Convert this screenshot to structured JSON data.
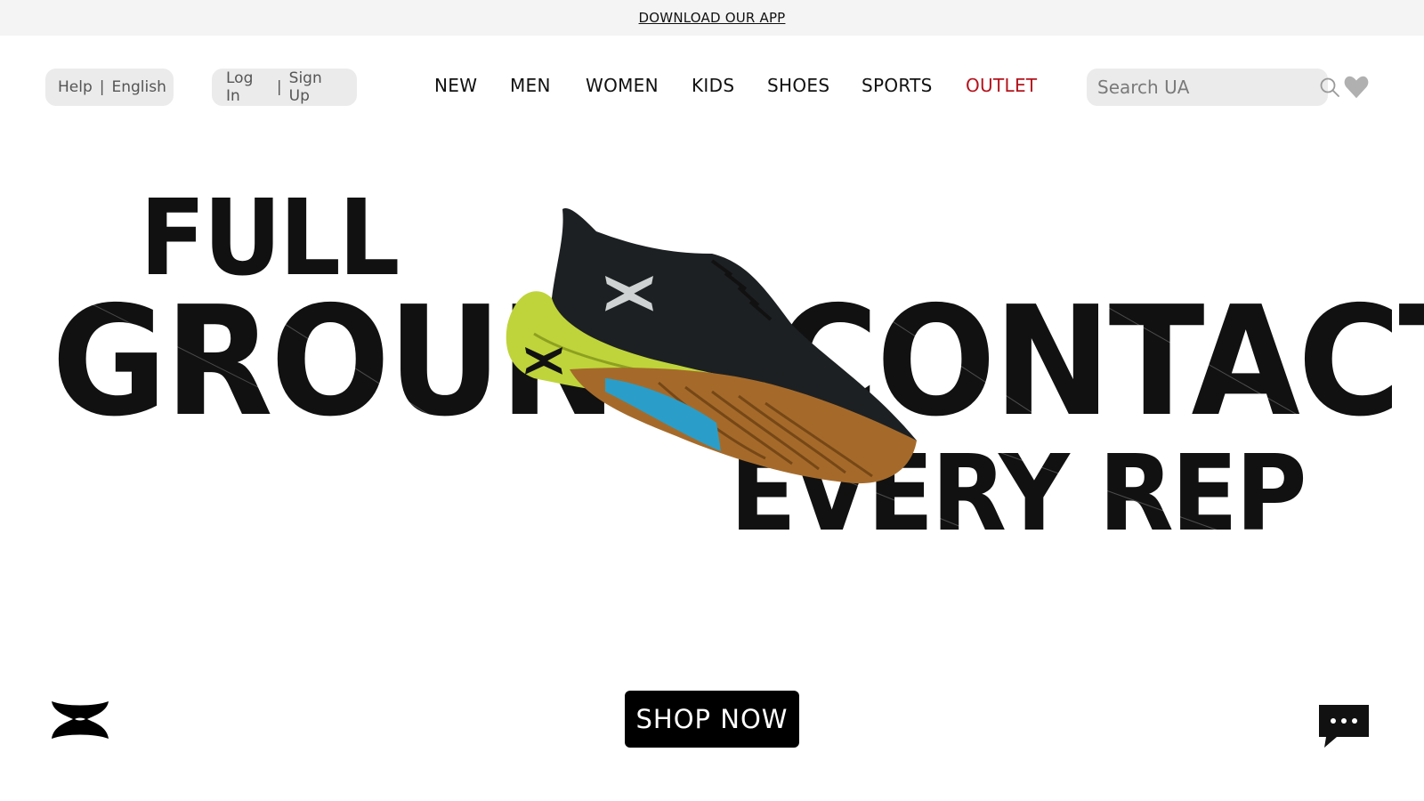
{
  "banner": {
    "link_text": "DOWNLOAD OUR APP"
  },
  "header": {
    "help": "Help",
    "language": "English",
    "separator": "|",
    "login": "Log In",
    "signup": "Sign Up",
    "nav": [
      {
        "label": "NEW"
      },
      {
        "label": "MEN"
      },
      {
        "label": "WOMEN"
      },
      {
        "label": "KIDS"
      },
      {
        "label": "SHOES"
      },
      {
        "label": "SPORTS"
      },
      {
        "label": "OUTLET",
        "color": "#b3141d"
      }
    ],
    "search_placeholder": "Search UA",
    "icons": {
      "search": "search-icon",
      "wishlist": "heart-icon"
    }
  },
  "hero": {
    "line1": "FULL",
    "line2": "GROUND CONTACT",
    "line3": "EVERY REP",
    "image": "training-shoe",
    "cta": "SHOP NOW"
  },
  "footer": {
    "logo": "under-armour-logo",
    "chat_icon": "chat-icon"
  },
  "colors": {
    "accent": "#b3141d",
    "text": "#111111",
    "pill_bg": "#ebebeb",
    "banner_bg": "#f4f4f4"
  }
}
